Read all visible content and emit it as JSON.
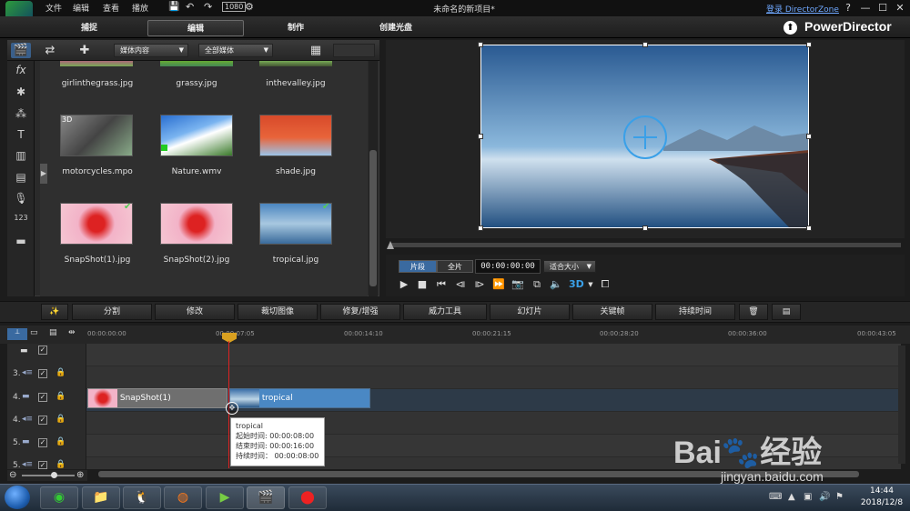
{
  "titlebar": {
    "menu": [
      "文件",
      "编辑",
      "查看",
      "播放"
    ],
    "title": "未命名的新项目*",
    "director_zone": "登录 DirectorZone",
    "window_buttons": [
      "?",
      "—",
      "☐",
      "✕"
    ]
  },
  "mode_tabs": {
    "capture": "捕捉",
    "edit": "编辑",
    "produce": "制作",
    "disc": "创建光盘"
  },
  "brand": "PowerDirector",
  "library": {
    "content_select": "媒体内容",
    "media_filter": "全部媒体",
    "rows": [
      {
        "labels": [
          "girlinthegrass.jpg",
          "grassy.jpg",
          "inthevalley.jpg"
        ]
      },
      {
        "labels": [
          "motorcycles.mpo",
          "Nature.wmv",
          "shade.jpg"
        ],
        "badges": [
          "3D",
          "",
          ""
        ]
      },
      {
        "labels": [
          "SnapShot(1).jpg",
          "SnapShot(2).jpg",
          "tropical.jpg"
        ]
      }
    ]
  },
  "preview": {
    "tab_clip": "片段",
    "tab_movie": "全片",
    "timecode": "00:00:00:00",
    "fit": "适合大小",
    "label_3d": "3D"
  },
  "timeline_toolbar": {
    "split": "分割",
    "edit": "修改",
    "crop": "裁切图像",
    "fix": "修复/增强",
    "magic": "威力工具",
    "slideshow": "幻灯片",
    "keyframe": "关键帧",
    "duration": "持续时间"
  },
  "ruler": [
    "00:00:00:00",
    "00:00:07:05",
    "00:00:14:10",
    "00:00:21:15",
    "00:00:28:20",
    "00:00:36:00",
    "00:00:43:05"
  ],
  "tracks": [
    "3.",
    "4.",
    "4.",
    "5.",
    "5."
  ],
  "clips": {
    "snapshot": "SnapShot(1)",
    "tropical": "tropical"
  },
  "tooltip": {
    "title": "tropical",
    "start": "起始时间: 00:00:08:00",
    "end": "结束时间: 00:00:16:00",
    "duration": "持续时间：  00:00:08:00"
  },
  "taskbar": {
    "time": "14:44",
    "date": "2018/12/8"
  },
  "watermark": {
    "logo": "Bai🐾经验",
    "url": "jingyan.baidu.com"
  },
  "colors": {
    "accent": "#3a6aa0",
    "playhead": "#dd2222",
    "marker": "#d9a020"
  }
}
